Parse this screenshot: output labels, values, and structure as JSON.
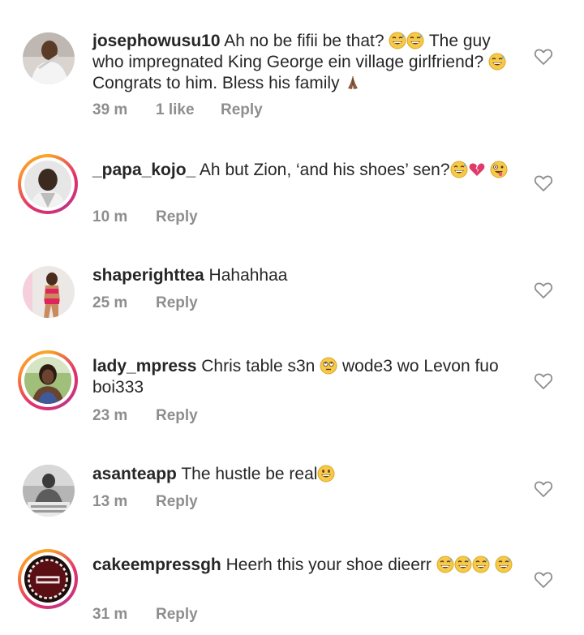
{
  "comments": [
    {
      "username": "josephowusu10",
      "segments": [
        {
          "t": "Ah no be fifii be that? "
        },
        {
          "e": "grin-sweat"
        },
        {
          "e": "grin-sweat"
        },
        {
          "t": " The guy who impregnated King George ein village girlfriend? "
        },
        {
          "e": "grin-sweat"
        },
        {
          "t": "Congrats to him. Bless his family "
        },
        {
          "e": "folded-hands"
        }
      ],
      "time": "39 m",
      "likes": "1 like",
      "reply": "Reply",
      "story_ring": false,
      "avatar_icon": "person-white-shirt-icon"
    },
    {
      "username": "_papa_kojo_",
      "segments": [
        {
          "t": "Ah but Zion, ‘and his shoes’ sen?"
        },
        {
          "e": "grin-sweat"
        },
        {
          "e": "broken-heart"
        },
        {
          "t": " "
        },
        {
          "e": "zany-face"
        }
      ],
      "time": "10 m",
      "likes": "",
      "reply": "Reply",
      "story_ring": true,
      "avatar_icon": "person-portrait-icon"
    },
    {
      "username": "shaperighttea",
      "segments": [
        {
          "t": "Hahahhaa"
        }
      ],
      "time": "25 m",
      "likes": "",
      "reply": "Reply",
      "story_ring": false,
      "avatar_icon": "woman-pink-outfit-icon"
    },
    {
      "username": "lady_mpress",
      "segments": [
        {
          "t": "Chris table s3n "
        },
        {
          "e": "eye-roll"
        },
        {
          "t": " wode3 wo Levon fuo boi333"
        }
      ],
      "time": "23 m",
      "likes": "",
      "reply": "Reply",
      "story_ring": true,
      "avatar_icon": "woman-outdoors-icon"
    },
    {
      "username": "asanteapp",
      "segments": [
        {
          "t": "The hustle be real"
        },
        {
          "e": "grin"
        }
      ],
      "time": "13 m",
      "likes": "",
      "reply": "Reply",
      "story_ring": false,
      "avatar_icon": "person-grayscale-icon"
    },
    {
      "username": "cakeempressgh",
      "segments": [
        {
          "t": "Heerh this your shoe dieerr "
        },
        {
          "e": "grin-sweat"
        },
        {
          "e": "grin-sweat"
        },
        {
          "e": "grin-sweat"
        },
        {
          "t": " "
        },
        {
          "e": "grin-sweat"
        }
      ],
      "time": "31 m",
      "likes": "",
      "reply": "Reply",
      "story_ring": true,
      "avatar_icon": "cake-logo-icon"
    }
  ],
  "colors": {
    "text": "#262626",
    "meta": "#8e8e8e",
    "heart_outline": "#8e8e8e"
  }
}
